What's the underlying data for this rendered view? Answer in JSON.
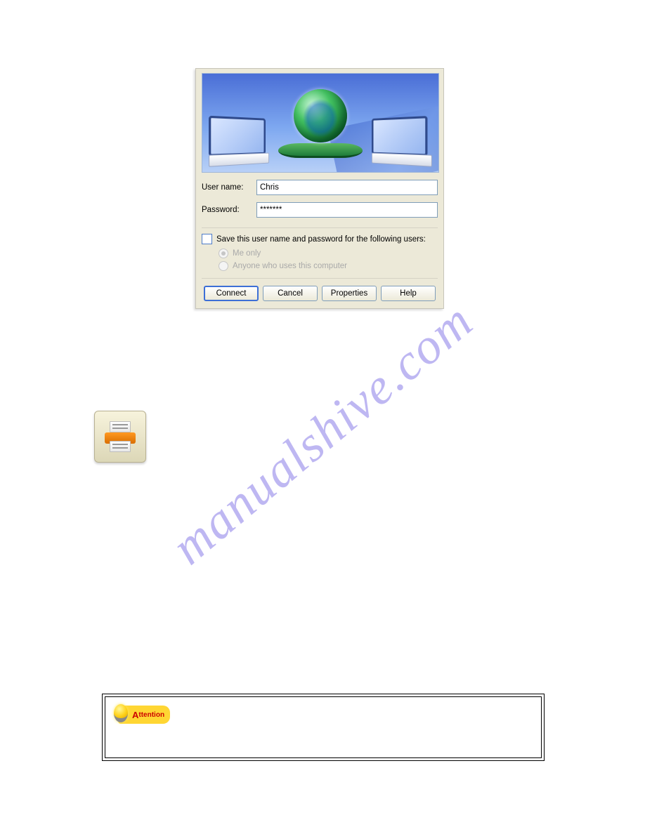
{
  "dialog": {
    "username_label": "User name:",
    "username_value": "Chris",
    "password_label": "Password:",
    "password_value": "*******",
    "save_checkbox_label": "Save this user name and password for the following users:",
    "radio_me_only": "Me only",
    "radio_anyone": "Anyone who uses this computer",
    "buttons": {
      "connect": "Connect",
      "cancel": "Cancel",
      "properties": "Properties",
      "help": "Help"
    }
  },
  "watermark": "manualshive.com",
  "attention": {
    "label_first": "A",
    "label_rest": "ttention"
  }
}
